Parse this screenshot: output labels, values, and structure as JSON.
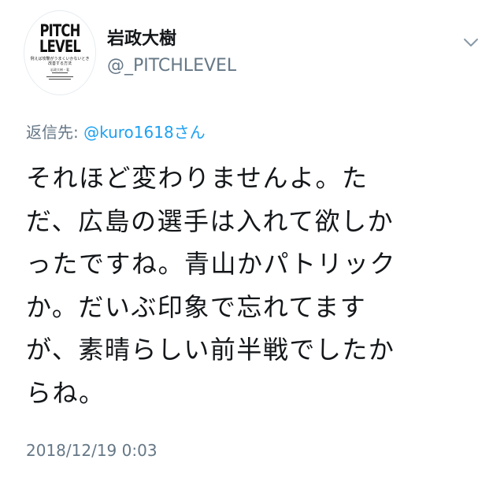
{
  "profile": {
    "display_name": "岩政大樹",
    "handle": "@_PITCHLEVEL",
    "avatar_book": {
      "title_line1": "PITCH",
      "title_line2": "LEVEL",
      "subtitle_line1": "例えば攻撃がうまくいかないとき",
      "subtitle_line2": "改善する方法",
      "author": "岩政大樹・著"
    }
  },
  "reply_to": {
    "prefix": "返信先:",
    "user": "@kuro1618さん"
  },
  "tweet": {
    "lines": [
      "それほど変わりませんよ。た",
      "だ、広島の選手は入れて欲しか",
      "ったですね。青山かパトリック",
      "か。だいぶ印象で忘れてます",
      "が、素晴らしい前半戦でしたか",
      "らね。"
    ],
    "timestamp": "2018/12/19 0:03"
  },
  "colors": {
    "text": "#14171a",
    "muted": "#657786",
    "link": "#1da1f2"
  },
  "icons": {
    "menu": "chevron-down-icon"
  }
}
